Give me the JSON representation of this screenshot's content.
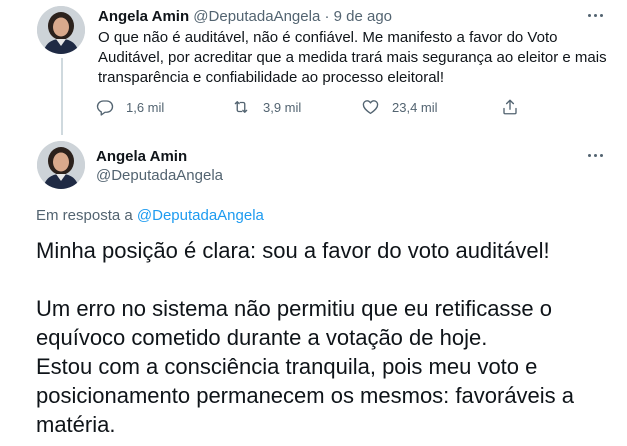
{
  "tweet1": {
    "name": "Angela Amin",
    "handle": "@DeputadaAngela",
    "separator": "·",
    "date": "9 de ago",
    "text": "O que não é auditável, não é confiável. Me manifesto a favor do Voto Auditável, por acreditar que a medida trará mais segurança ao eleitor e mais transparência e confiabilidade ao processo eleitoral!",
    "actions": {
      "reply_count": "1,6 mil",
      "retweet_count": "3,9 mil",
      "like_count": "23,4 mil"
    },
    "icons": [
      "more-icon",
      "reply-icon",
      "retweet-icon",
      "like-icon",
      "share-icon"
    ]
  },
  "tweet2": {
    "name": "Angela Amin",
    "handle": "@DeputadaAngela",
    "reply_prefix": "Em resposta a",
    "reply_handle": "@DeputadaAngela",
    "paragraph1": "Minha posição é clara: sou a favor do voto auditável!",
    "paragraph2": "Um erro no sistema não permitiu que eu retificasse o equívoco cometido durante a votação de hoje.",
    "paragraph3": "Estou com a consciência tranquila, pois meu voto e posicionamento permanecem os mesmos: favoráveis a matéria."
  },
  "colors": {
    "text": "#0f1419",
    "muted": "#536471",
    "link": "#1d9bf0",
    "thread_line": "#cfd9de"
  }
}
